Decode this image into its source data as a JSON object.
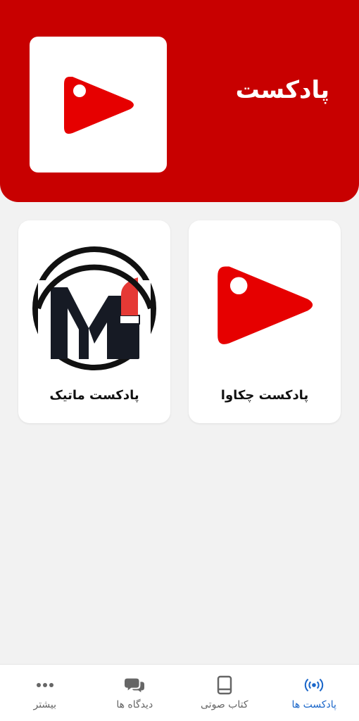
{
  "colors": {
    "header_bg": "#c80000",
    "brand_red": "#e60000",
    "active_nav": "#1a66c9",
    "inactive_nav": "#666666"
  },
  "header": {
    "title": "پادکست",
    "logo_icon": "play-tag-logo"
  },
  "podcasts": [
    {
      "label": "پادکست ماتیک",
      "icon": "mi-lipstick-logo"
    },
    {
      "label": "پادکست چکاوا",
      "icon": "play-tag-logo"
    }
  ],
  "bottom_nav": {
    "items": [
      {
        "label": "بیشتر",
        "icon": "more-dots-icon",
        "active": false
      },
      {
        "label": "دیدگاه ها",
        "icon": "chat-bubbles-icon",
        "active": false
      },
      {
        "label": "کتاب صوتی",
        "icon": "book-icon",
        "active": false
      },
      {
        "label": "پادکست ها",
        "icon": "podcast-broadcast-icon",
        "active": true
      }
    ]
  }
}
